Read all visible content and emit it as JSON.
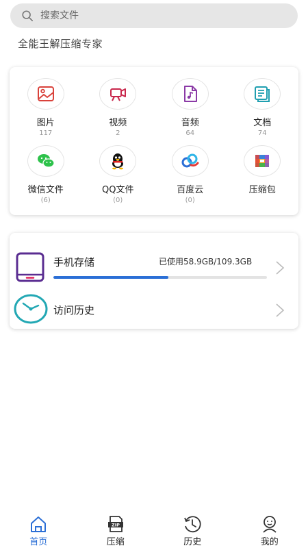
{
  "search": {
    "placeholder": "搜索文件"
  },
  "tagline": "全能王解压缩专家",
  "categories": [
    {
      "label": "图片",
      "count": "117",
      "icon": "image-icon"
    },
    {
      "label": "视频",
      "count": "2",
      "icon": "video-icon"
    },
    {
      "label": "音频",
      "count": "64",
      "icon": "audio-icon"
    },
    {
      "label": "文档",
      "count": "74",
      "icon": "document-icon"
    },
    {
      "label": "微信文件",
      "count": "(6)",
      "icon": "wechat-icon"
    },
    {
      "label": "QQ文件",
      "count": "(0)",
      "icon": "qq-icon"
    },
    {
      "label": "百度云",
      "count": "(0)",
      "icon": "baidu-cloud-icon"
    },
    {
      "label": "压缩包",
      "count": "",
      "icon": "archive-icon"
    }
  ],
  "storage": {
    "title": "手机存储",
    "usage": "已使用58.9GB/109.3GB",
    "used_fraction": 0.539
  },
  "history": {
    "title": "访问历史"
  },
  "tabs": [
    {
      "label": "首页",
      "icon": "home-icon",
      "active": true
    },
    {
      "label": "压缩",
      "icon": "zip-icon",
      "active": false
    },
    {
      "label": "历史",
      "icon": "history-icon",
      "active": false
    },
    {
      "label": "我的",
      "icon": "profile-icon",
      "active": false
    }
  ],
  "colors": {
    "accent": "#2b6fd6",
    "phone": "#5a2d91",
    "clock": "#23a8b4"
  }
}
